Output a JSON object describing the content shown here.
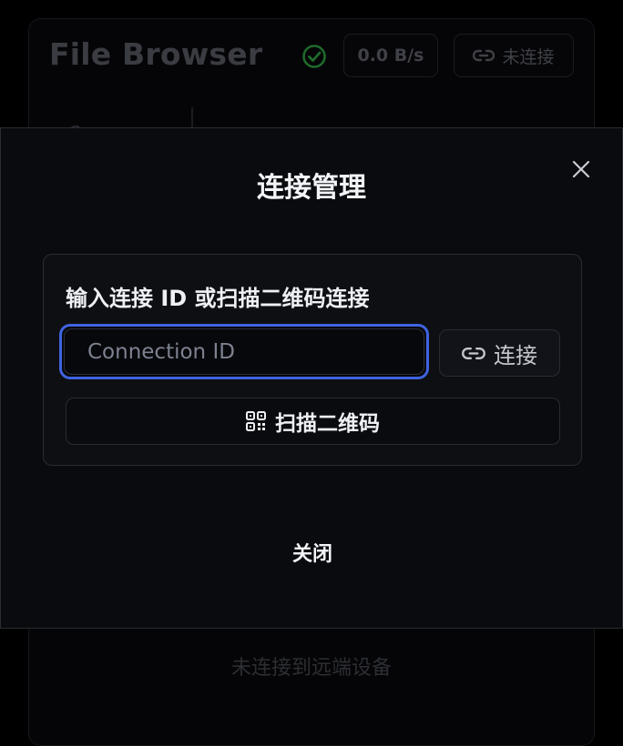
{
  "app": {
    "title": "File Browser",
    "speed": "0.0 B/s",
    "connection_status": "未连接",
    "status_message": "未连接到远端设备"
  },
  "modal": {
    "title": "连接管理",
    "prompt": "输入连接 ID 或扫描二维码连接",
    "input_placeholder": "Connection ID",
    "input_value": "",
    "connect_label": "连接",
    "scan_label": "扫描二维码",
    "close_label": "关闭"
  },
  "icons": {
    "status": "check-circle-icon",
    "link": "link-icon",
    "qr": "qr-code-icon",
    "close": "close-icon"
  },
  "colors": {
    "accent": "#3f63e0",
    "success": "#2f8f3e",
    "background": "#000000",
    "modal_bg": "#0a0b0e"
  }
}
